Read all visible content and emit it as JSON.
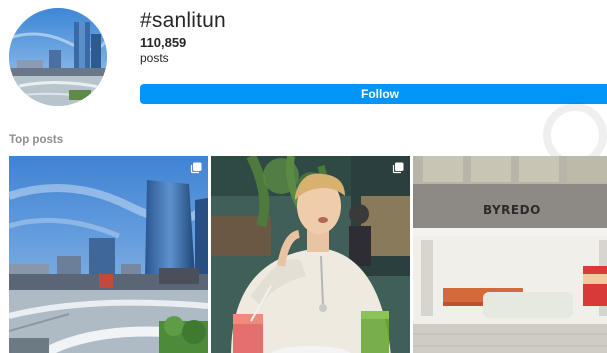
{
  "header": {
    "hashtag": "#sanlitun",
    "post_count": "110,859",
    "post_count_label": "posts",
    "follow_label": "Follow"
  },
  "top_posts": {
    "title": "Top posts",
    "posts": [
      {
        "name": "post-1",
        "type": "carousel",
        "icon": "multiple-photos-icon"
      },
      {
        "name": "post-2",
        "type": "carousel",
        "icon": "multiple-photos-icon"
      },
      {
        "name": "post-3",
        "type": "photo",
        "sign_text": "BYREDO"
      }
    ]
  },
  "colors": {
    "follow_button": "#0095f6",
    "section_title": "#8e8e8e",
    "text": "#262626"
  }
}
